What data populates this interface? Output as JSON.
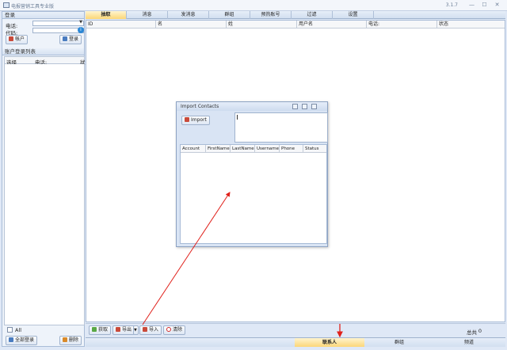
{
  "window": {
    "title": "电报营销工具专业版",
    "version": "3.1.7",
    "minimize": "—",
    "maximize": "☐",
    "close": "✕"
  },
  "login": {
    "header": "登录",
    "phone_label": "电话:",
    "proxy_label": "代码:",
    "account_button": "帐户",
    "login_button": "登录"
  },
  "accounts": {
    "header": "账户登录列表",
    "columns": [
      "选择",
      "电话:",
      "状"
    ],
    "all_label": "All",
    "login_all_button": "全部登录",
    "delete_button": "删除"
  },
  "tabs": [
    "抽取",
    "消息",
    "发消息",
    "群组",
    "预热账号",
    "过滤",
    "设置"
  ],
  "active_tab": "抽取",
  "grid": {
    "columns": [
      "ID",
      "名",
      "姓",
      "用户名",
      "电话:",
      "状态"
    ]
  },
  "toolbar": {
    "fetch": "获取",
    "export": "导出",
    "import": "导入",
    "clear": "清除",
    "total_label": "总共",
    "total_value": "0"
  },
  "bottom_tabs": [
    "联系人",
    "群组",
    "频道"
  ],
  "active_bottom_tab": "联系人",
  "dialog": {
    "title": "Import Contacts",
    "import_button": "Import",
    "columns": [
      "Account",
      "FirstName",
      "LastName",
      "Username",
      "Phone",
      "Status"
    ]
  },
  "colors": {
    "accent_tab": "#fbd677",
    "annotation_arrow": "#e0201a",
    "window_bg": "#dfe8f6"
  }
}
